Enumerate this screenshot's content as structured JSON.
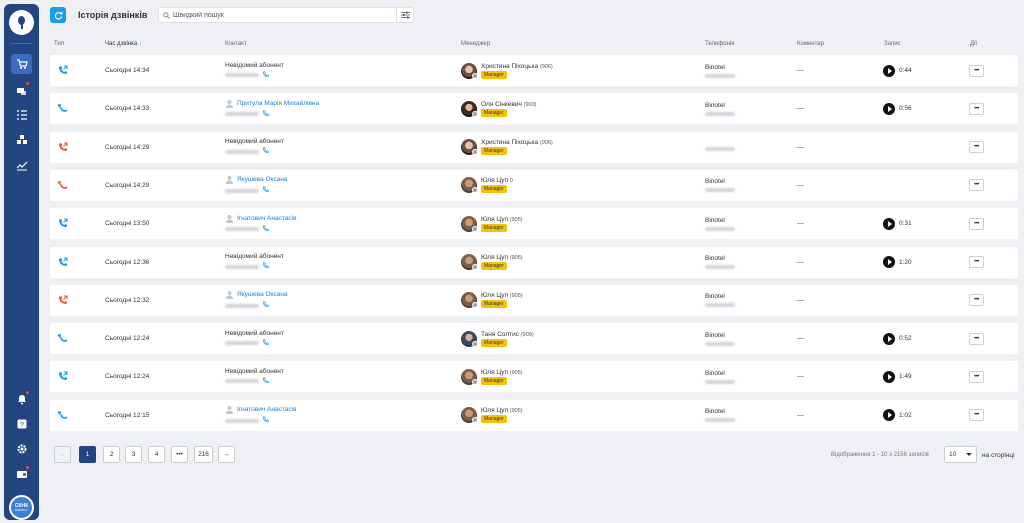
{
  "header": {
    "title": "Історія дзвінків",
    "search_placeholder": "Швидкий пошук"
  },
  "columns": {
    "type": "Тип",
    "time": "Час дзвінка",
    "sort_arrow": "↓",
    "contact": "Контакт",
    "manager": "Менеджер",
    "telephony": "Телефонія",
    "comment": "Коментар",
    "record": "Запис",
    "actions": "Дії"
  },
  "sidebar": {
    "brand_main": "СКНК",
    "brand_sub": "ENERGY"
  },
  "colors": {
    "outgoing": "#1a9ce6",
    "missed": "#ee5a3a",
    "incoming": "#1a9ce6",
    "badge": "#f4c20d"
  },
  "rows": [
    {
      "call_type": "outgoing",
      "time": "Сьогодні 14:34",
      "contact": "Невідомий абонент",
      "contact_link": false,
      "manager": "Христина Піхоцька",
      "ext": "(906)",
      "role": "Manager",
      "telephony": "Binotel",
      "comment": "—",
      "record": "0:44",
      "actions": "•••"
    },
    {
      "call_type": "incoming",
      "time": "Сьогодні 14:33",
      "contact": "Притула Марія Михайлівна",
      "contact_link": true,
      "manager": "Оля Сінкевич",
      "ext": "(903)",
      "role": "Manager",
      "telephony": "Binotel",
      "comment": "—",
      "record": "0:56",
      "actions": "•••"
    },
    {
      "call_type": "missed-out",
      "time": "Сьогодні 14:29",
      "contact": "Невідомий абонент",
      "contact_link": false,
      "manager": "Христина Піхоцька",
      "ext": "(906)",
      "role": "Manager",
      "telephony": "",
      "comment": "—",
      "record": "",
      "actions": "•••"
    },
    {
      "call_type": "missed-in",
      "time": "Сьогодні 14:29",
      "contact": "Якушева Оксана",
      "contact_link": true,
      "manager": "Юля Цуп",
      "ext": "0",
      "role": "Manager",
      "telephony": "Binotel",
      "comment": "—",
      "record": "",
      "actions": "•••"
    },
    {
      "call_type": "outgoing",
      "time": "Сьогодні 13:50",
      "contact": "Ігнатович Анастасія",
      "contact_link": true,
      "manager": "Юля Цуп",
      "ext": "(905)",
      "role": "Manager",
      "telephony": "Binotel",
      "comment": "—",
      "record": "0:31",
      "actions": "•••"
    },
    {
      "call_type": "outgoing",
      "time": "Сьогодні 12:36",
      "contact": "Невідомий абонент",
      "contact_link": false,
      "manager": "Юля Цуп",
      "ext": "(905)",
      "role": "Manager",
      "telephony": "Binotel",
      "comment": "—",
      "record": "1:20",
      "actions": "•••"
    },
    {
      "call_type": "missed-out",
      "time": "Сьогодні 12:32",
      "contact": "Якушева Оксана",
      "contact_link": true,
      "manager": "Юля Цуп",
      "ext": "(905)",
      "role": "Manager",
      "telephony": "Binotel",
      "comment": "—",
      "record": "",
      "actions": "•••"
    },
    {
      "call_type": "incoming",
      "time": "Сьогодні 12:24",
      "contact": "Невідомий абонент",
      "contact_link": false,
      "manager": "Таня Солтис",
      "ext": "(909)",
      "role": "Manager",
      "telephony": "Binotel",
      "comment": "—",
      "record": "0:52",
      "actions": "•••"
    },
    {
      "call_type": "outgoing",
      "time": "Сьогодні 12:24",
      "contact": "Невідомий абонент",
      "contact_link": false,
      "manager": "Юля Цуп",
      "ext": "(905)",
      "role": "Manager",
      "telephony": "Binotel",
      "comment": "—",
      "record": "1:49",
      "actions": "•••"
    },
    {
      "call_type": "incoming",
      "time": "Сьогодні 12:15",
      "contact": "Ігнатович Анастасія",
      "contact_link": true,
      "manager": "Юля Цуп",
      "ext": "(905)",
      "role": "Manager",
      "telephony": "Binotel",
      "comment": "—",
      "record": "1:02",
      "actions": "•••"
    }
  ],
  "pagination": {
    "prev": "←",
    "pages": [
      "1",
      "2",
      "3",
      "4",
      "•••",
      "216"
    ],
    "next": "→",
    "info": "Відображення 1 - 10 з 2156 записів",
    "per_page": "10",
    "per_page_label": "на сторінці"
  }
}
